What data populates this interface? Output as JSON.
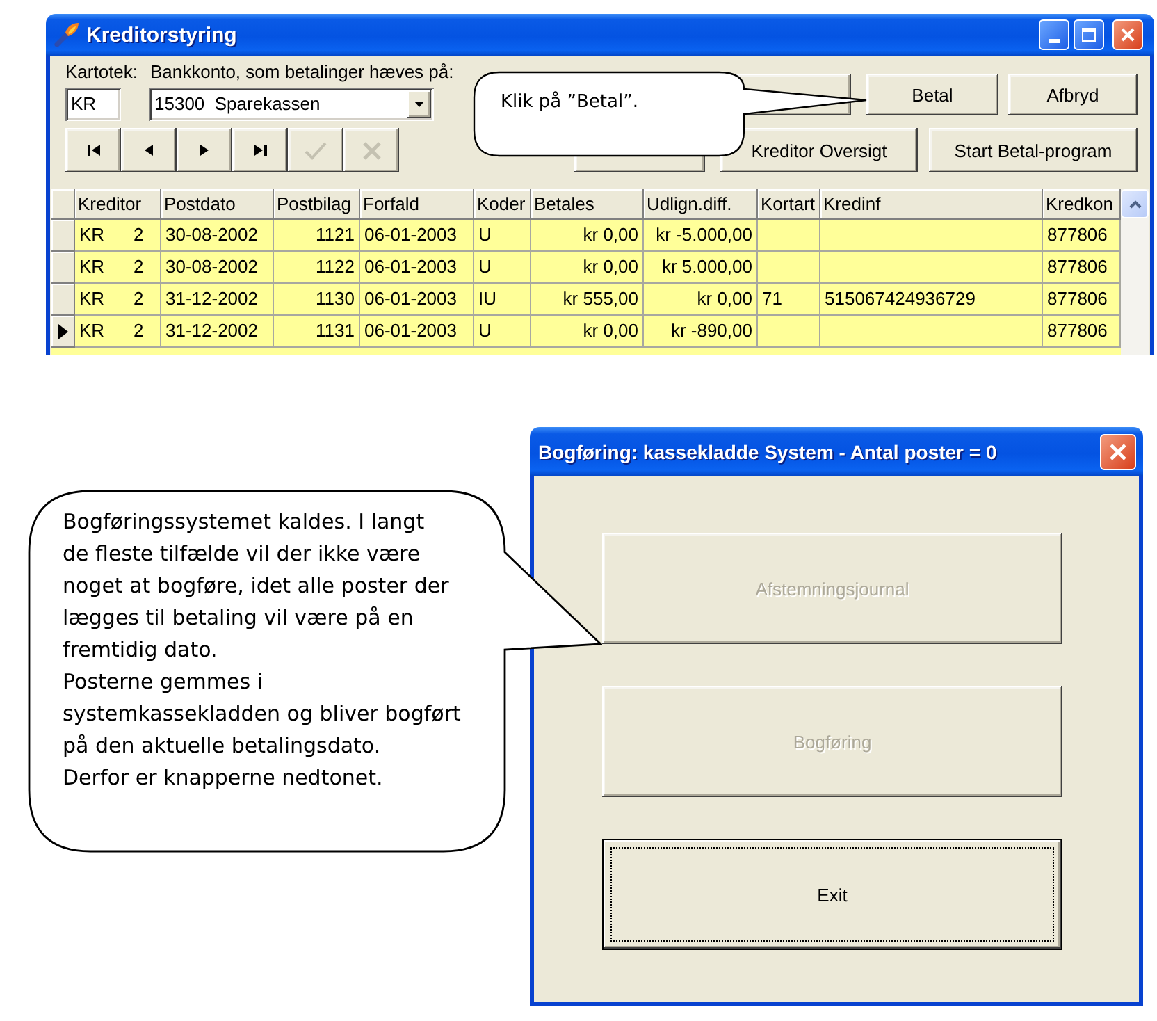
{
  "top_window": {
    "title": "Kreditorstyring",
    "kartotek_label": "Kartotek:",
    "bank_label": "Bankkonto, som betalinger hæves på:",
    "kartotek_field": {
      "value": "KR"
    },
    "bank_combo": {
      "value": "15300  Sparekassen"
    },
    "nav_buttons": [
      {
        "kind": "first",
        "disabled": false
      },
      {
        "kind": "previous",
        "disabled": false
      },
      {
        "kind": "next",
        "disabled": false
      },
      {
        "kind": "last",
        "disabled": false
      },
      {
        "kind": "confirm",
        "disabled": true
      },
      {
        "kind": "cancel",
        "disabled": true
      }
    ],
    "button_rows": [
      [
        {
          "kind": "covered"
        },
        {
          "kind": "labeled",
          "label": "Betal"
        },
        {
          "kind": "labeled",
          "label": "Afbryd"
        }
      ],
      [
        {
          "kind": "covered"
        },
        {
          "kind": "labeled",
          "label": "Kreditor Oversigt"
        },
        {
          "kind": "labeled",
          "label": "Start Betal-program"
        }
      ]
    ],
    "callout": {
      "text": "Klik på ”Betal”."
    },
    "table": {
      "columns": [
        "Kreditor",
        "Postdato",
        "Postbilag",
        "Forfald",
        "Koder",
        "Betales",
        "Udlign.diff.",
        "Kortart",
        "Kredinf",
        "Kredkon"
      ],
      "rows": [
        {
          "current": false,
          "kreditor": "KR",
          "kreditor_nr": "2",
          "postdato": "30-08-2002",
          "postbilag": "1121",
          "forfald": "06-01-2003",
          "koder": "U",
          "betales": "kr 0,00",
          "udlign_diff": "kr -5.000,00",
          "kredkon": "877806"
        },
        {
          "current": false,
          "kreditor": "KR",
          "kreditor_nr": "2",
          "postdato": "30-08-2002",
          "postbilag": "1122",
          "forfald": "06-01-2003",
          "koder": "U",
          "betales": "kr 0,00",
          "udlign_diff": "kr 5.000,00",
          "kredkon": "877806"
        },
        {
          "current": false,
          "kreditor": "KR",
          "kreditor_nr": "2",
          "postdato": "31-12-2002",
          "postbilag": "1130",
          "forfald": "06-01-2003",
          "koder": "IU",
          "betales": "kr 555,00",
          "udlign_diff": "kr 0,00",
          "kortart": "71",
          "kredinf": "515067424936729",
          "kredkon": "877806"
        },
        {
          "current": true,
          "kreditor": "KR",
          "kreditor_nr": "2",
          "postdato": "31-12-2002",
          "postbilag": "1131",
          "forfald": "06-01-2003",
          "koder": "U",
          "betales": "kr 0,00",
          "udlign_diff": "kr -890,00",
          "kredkon": "877806"
        }
      ]
    }
  },
  "note_bubble": {
    "text": "Bogføringssystemet kaldes. I langt\nde fleste tilfælde vil der ikke være\nnoget at bogføre, idet alle poster der\nlægges til betaling vil være på en\nfremtidig dato.\nPosterne gemmes i\nsystemkassekladden og bliver bogført\npå den aktuelle betalingsdato.\nDerfor er knapperne nedtonet."
  },
  "bottom_window": {
    "title": "Bogføring: kassekladde System - Antal poster = 0",
    "buttons": [
      {
        "label": "Afstemningsjournal",
        "disabled": true,
        "focused": false
      },
      {
        "label": "Bogføring",
        "disabled": true,
        "focused": false
      },
      {
        "label": "Exit",
        "disabled": false,
        "focused": true
      }
    ]
  }
}
